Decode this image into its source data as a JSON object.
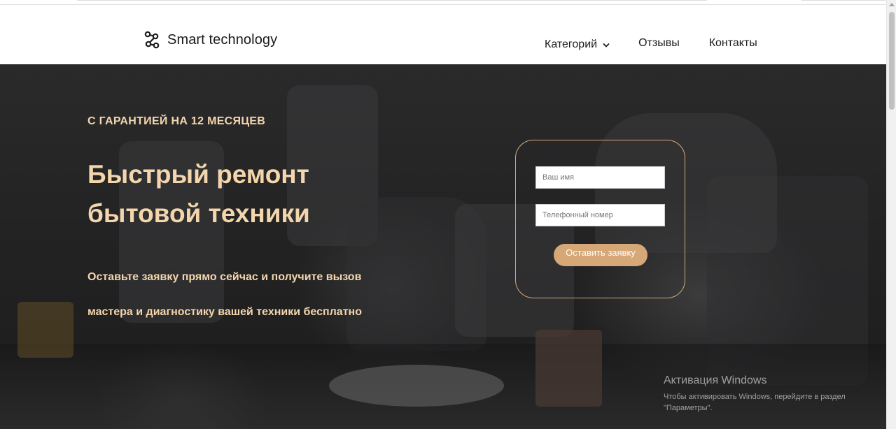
{
  "header": {
    "logo_text": "Smart technology",
    "logo_icon": "link-nodes-icon",
    "nav": {
      "categories": "Категорий",
      "reviews": "Отзывы",
      "contacts": "Контакты"
    }
  },
  "hero": {
    "badge": "С ГАРАНТИЕЙ НА 12 МЕСЯЦЕВ",
    "title_line1": "Быстрый ремонт",
    "title_line2": "бытовой техники",
    "subtitle_line1": "Оставьте заявку прямо сейчас и получите вызов",
    "subtitle_line2": "мастера и диагностику вашей техники бесплатно"
  },
  "form": {
    "name_placeholder": "Ваш имя",
    "phone_placeholder": "Телефонный номер",
    "submit_label": "Оставить заявку"
  },
  "watermark": {
    "title": "Активация Windows",
    "line1": "Чтобы активировать Windows, перейдите в раздел",
    "line2": "\"Параметры\"."
  },
  "colors": {
    "accent_text": "#f4d6ad",
    "button": "#d6a777",
    "form_border": "#d6a977"
  }
}
